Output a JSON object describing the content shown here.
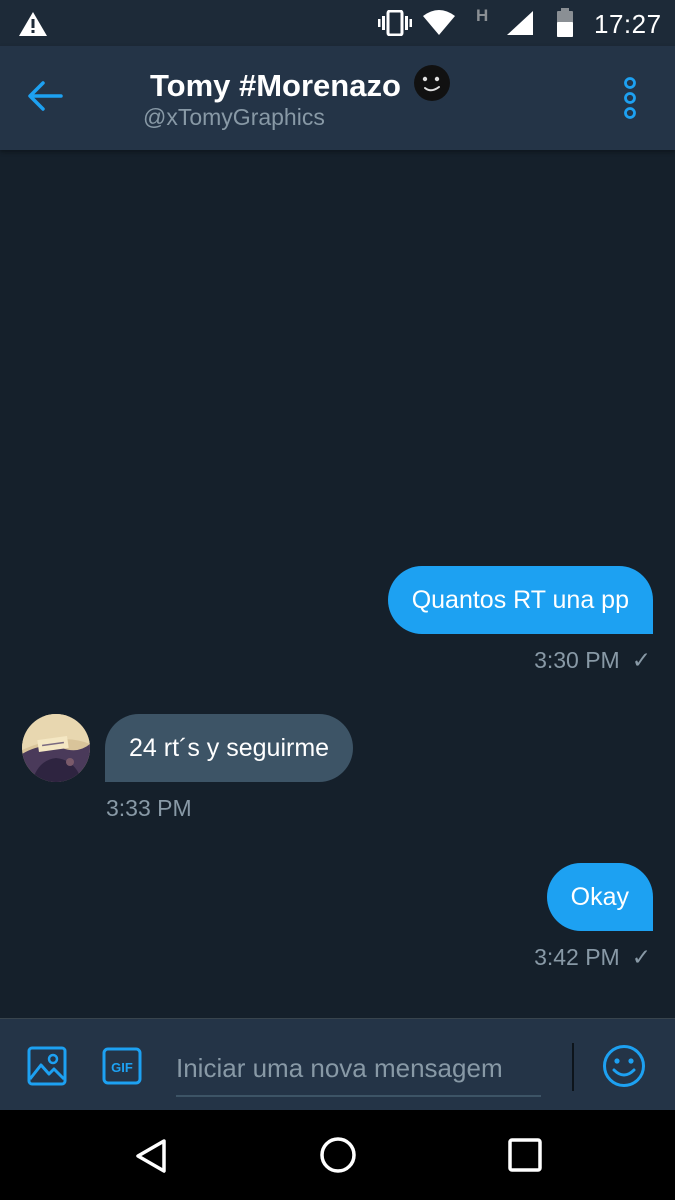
{
  "status_bar": {
    "time": "17:27",
    "network_type": "H",
    "icons": [
      "warning-icon",
      "vibrate-icon",
      "wifi-icon",
      "signal-icon",
      "battery-icon"
    ]
  },
  "header": {
    "name": "Tomy #Morenazo",
    "handle": "@xTomyGraphics",
    "icons": [
      "back-arrow-icon",
      "face-emoji-icon",
      "more-vertical-icon"
    ]
  },
  "messages": [
    {
      "direction": "outgoing",
      "text": "Quantos RT una pp",
      "time": "3:30 PM",
      "status": "✓"
    },
    {
      "direction": "incoming",
      "text": "24 rt´s y seguirme",
      "time": "3:33 PM"
    },
    {
      "direction": "outgoing",
      "text": "Okay",
      "time": "3:42 PM",
      "status": "✓"
    }
  ],
  "composer": {
    "placeholder": "Iniciar uma nova mensagem",
    "gif_label": "GIF",
    "icons": [
      "image-icon",
      "gif-icon",
      "emoji-icon"
    ]
  },
  "nav_bar": {
    "icons": [
      "nav-back-icon",
      "nav-home-icon",
      "nav-recents-icon"
    ]
  },
  "colors": {
    "background": "#15202b",
    "header": "#243447",
    "accent": "#1da1f2",
    "incoming_bubble": "#3d5466",
    "secondary_text": "#8899a6"
  }
}
